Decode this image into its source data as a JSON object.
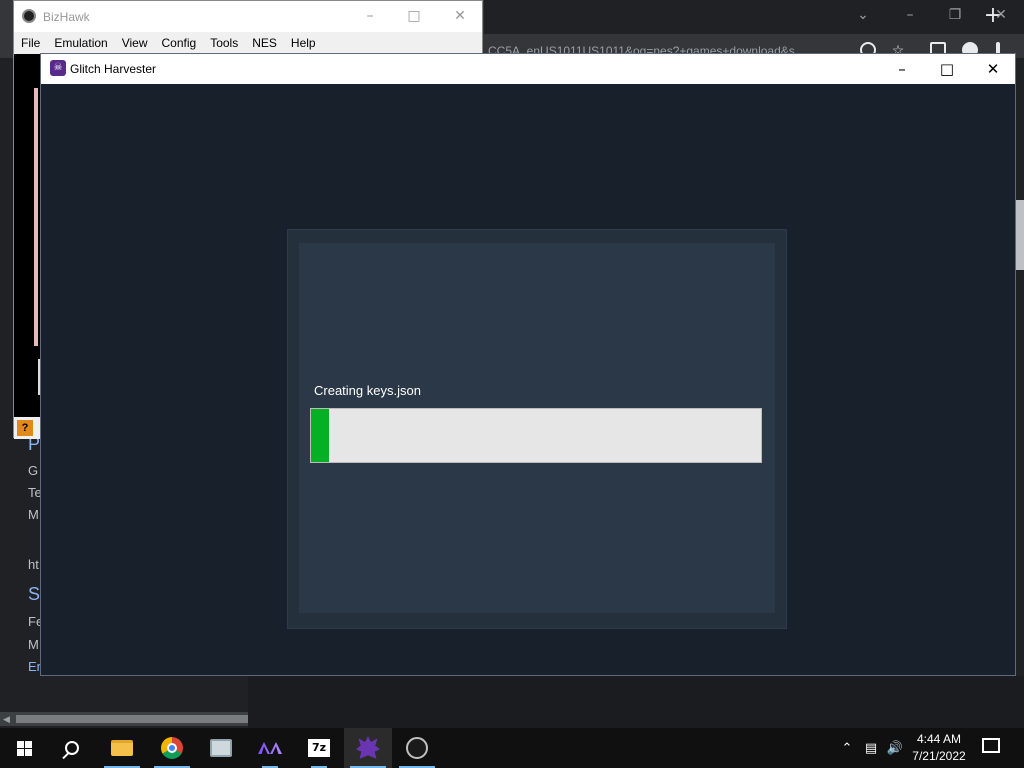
{
  "chrome": {
    "new_tab_glyph": "+",
    "omnibox_text": "CC5A_enUS1011US1011&oq=nes?+games+download&s",
    "page_side_text": [
      "G",
      "Te",
      "M",
      "ht",
      "Fe",
      "M",
      "Er"
    ],
    "page_side_links": [
      "P",
      "S"
    ]
  },
  "bizhawk": {
    "title": "BizHawk",
    "menu": [
      "File",
      "Emulation",
      "View",
      "Config",
      "Tools",
      "NES",
      "Help"
    ],
    "status_icon_glyph": "?"
  },
  "glitch_harvester": {
    "title": "Glitch Harvester",
    "progress": {
      "status_text": "Creating keys.json",
      "fraction": 0.04,
      "fill_color": "#06b025"
    }
  },
  "taskbar": {
    "apps": [
      "start",
      "search",
      "file-explorer",
      "chrome",
      "photos",
      "vs-code",
      "7-zip",
      "glitch-harvester",
      "bizhawk"
    ],
    "active_app": "glitch-harvester",
    "sevenzip_label": "7z",
    "clock_time": "4:44 AM",
    "clock_date": "7/21/2022"
  }
}
